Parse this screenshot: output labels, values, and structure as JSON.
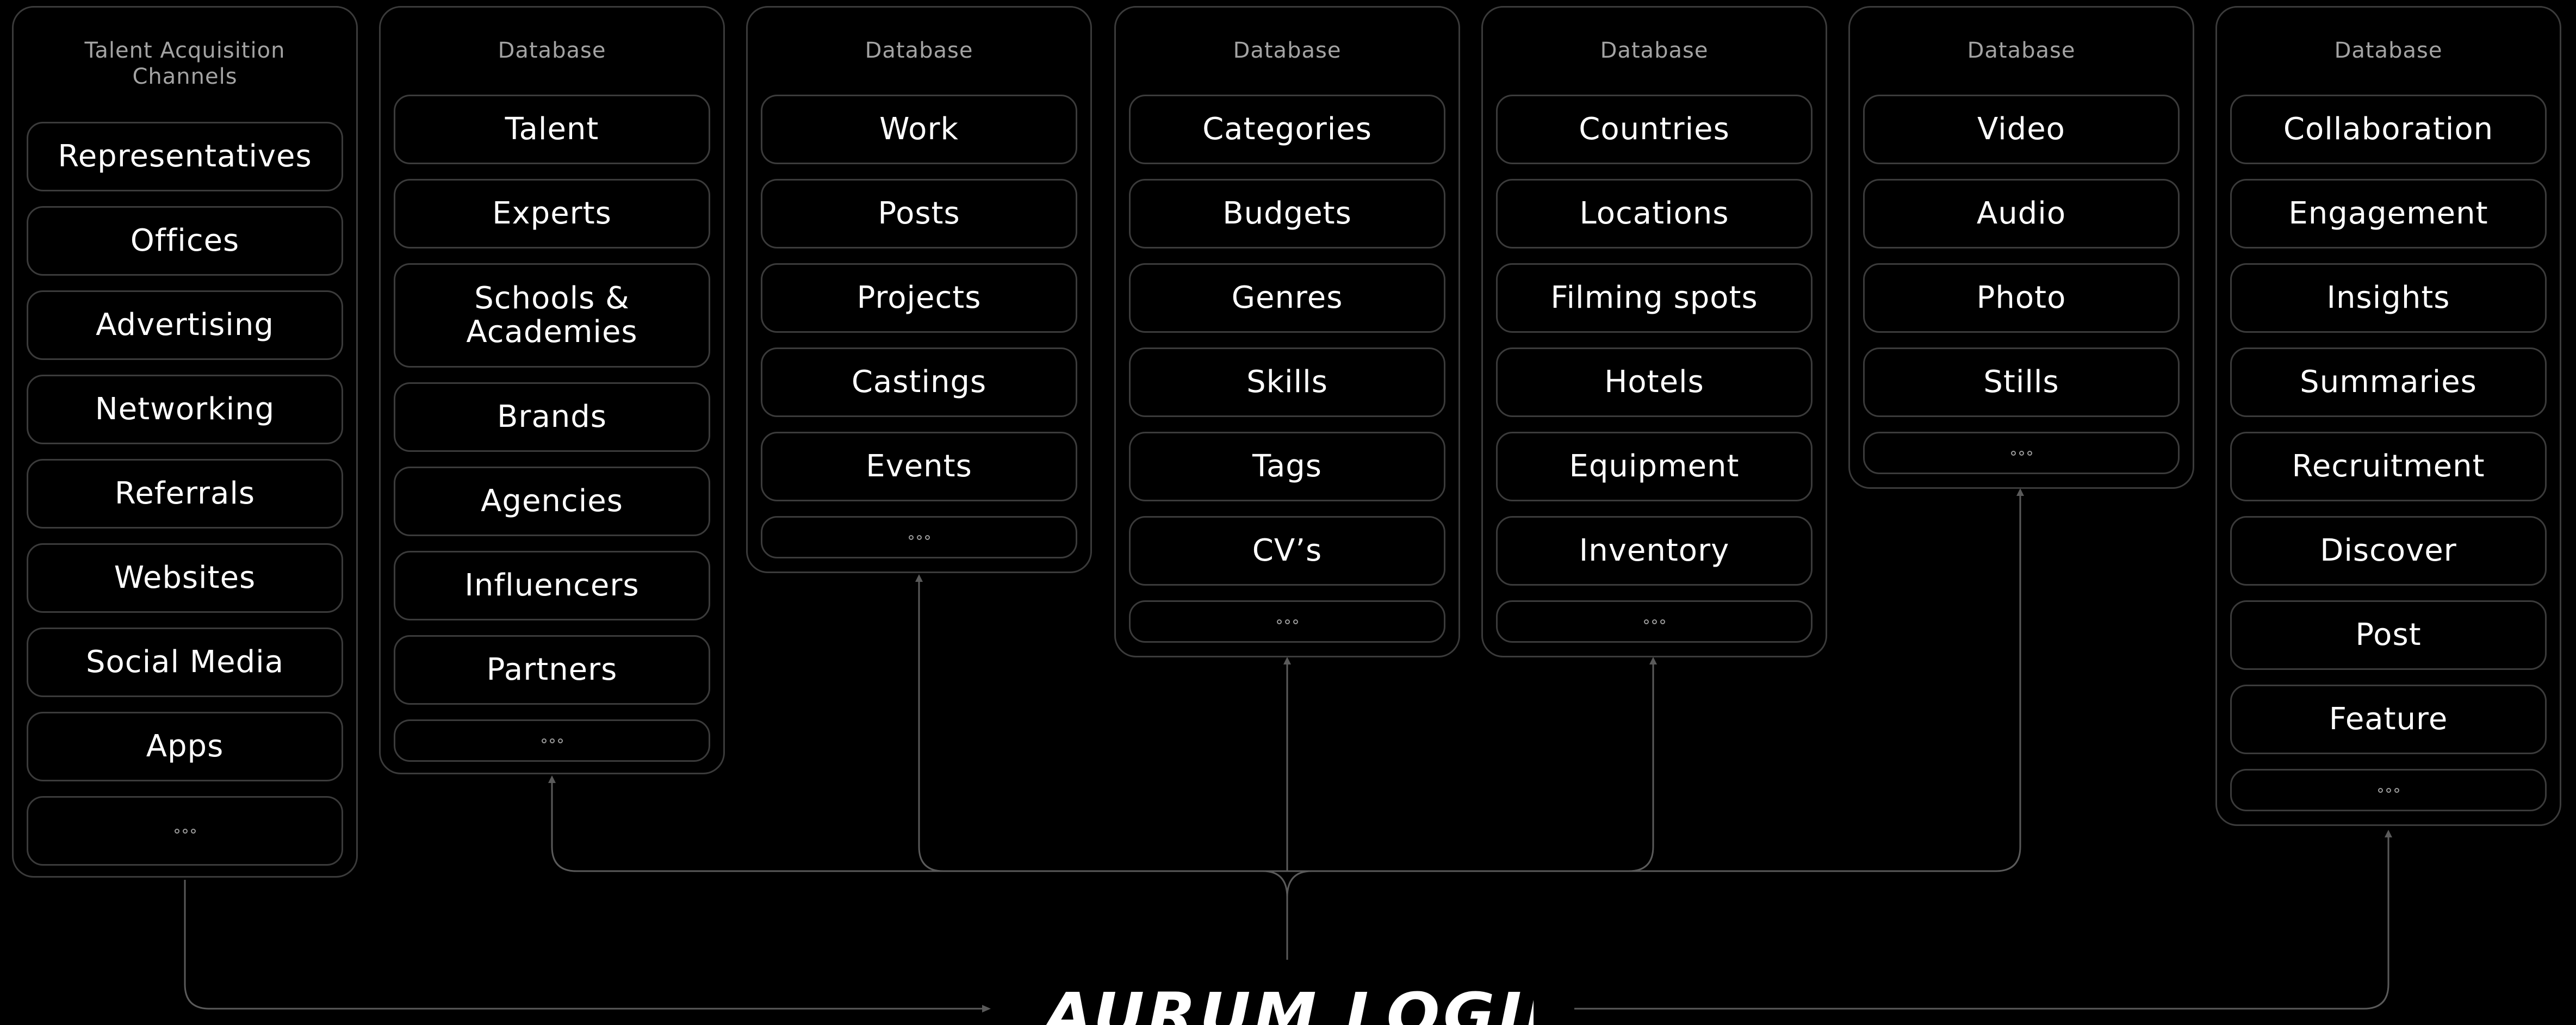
{
  "columns": [
    {
      "title": "Talent Acquisition Channels",
      "items": [
        "Representatives",
        "Offices",
        "Advertising",
        "Networking",
        "Referrals",
        "Websites",
        "Social Media",
        "Apps"
      ]
    },
    {
      "title": "Database",
      "items": [
        "Talent",
        "Experts",
        "Schools & Academies",
        "Brands",
        "Agencies",
        "Influencers",
        "Partners"
      ]
    },
    {
      "title": "Database",
      "items": [
        "Work",
        "Posts",
        "Projects",
        "Castings",
        "Events"
      ]
    },
    {
      "title": "Database",
      "items": [
        "Categories",
        "Budgets",
        "Genres",
        "Skills",
        "Tags",
        "CV’s"
      ]
    },
    {
      "title": "Database",
      "items": [
        "Countries",
        "Locations",
        "Filming spots",
        "Hotels",
        "Equipment",
        "Inventory"
      ]
    },
    {
      "title": "Database",
      "items": [
        "Video",
        "Audio",
        "Photo",
        "Stills"
      ]
    },
    {
      "title": "Database",
      "items": [
        "Collaboration",
        "Engagement",
        "Insights",
        "Summaries",
        "Recruitment",
        "Discover",
        "Post",
        "Feature"
      ]
    }
  ],
  "logo": {
    "text": "AURUM LOGIK",
    "mark": "®"
  },
  "colors": {
    "background": "#000000",
    "border": "#3b3b3b",
    "text": "#ffffff",
    "muted": "#a3a3a3"
  }
}
